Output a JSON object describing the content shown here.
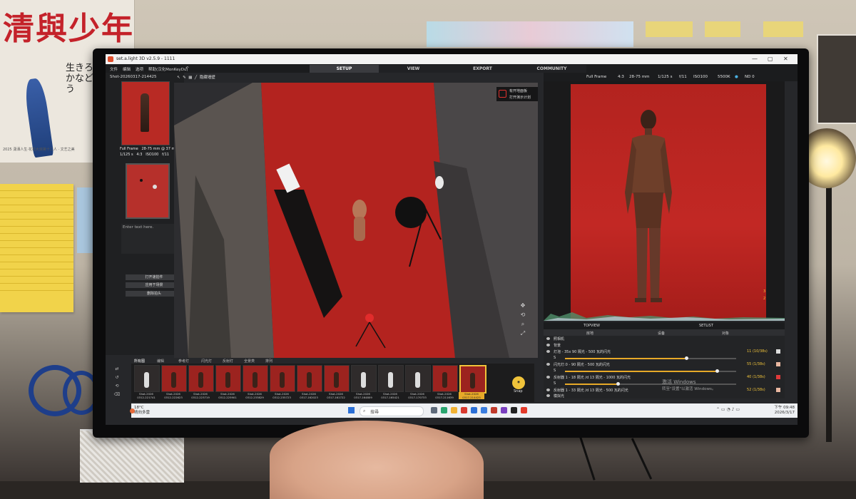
{
  "surroundings": {
    "poster_big_text": "清與少年",
    "poster_vertical_text": "生きろかなどう",
    "poster_fine_print": "2025 潇洒人生·花花大浪第十二人 · 文艺之美"
  },
  "window": {
    "title": "set.a.light 3D v2.5.9 - 1111",
    "controls": [
      "—",
      "▢",
      "✕"
    ]
  },
  "menu": {
    "items": [
      "文件",
      "编辑",
      "选项",
      "帮助(汉化MonKeyDu)"
    ]
  },
  "main_tabs": [
    {
      "label": "SETUP",
      "active": true
    },
    {
      "label": "VIEW",
      "active": false
    },
    {
      "label": "EXPORT",
      "active": false
    },
    {
      "label": "COMMUNITY",
      "active": false
    }
  ],
  "camera_toolbar": {
    "sensor": "Full Frame",
    "ratio": "4:3",
    "lens": "28-75 mm",
    "shutter": "1/125 s",
    "aperture": "f/11",
    "iso": "ISO100",
    "wb": "5500K",
    "nd": "ND 0"
  },
  "left_panel": {
    "shot_name": "Shot-20260317-214425",
    "sensor": "Full Frame",
    "lens_info": "28-75 mm @ 37 mm",
    "shutter": "1/125 s",
    "ratio": "4:3",
    "iso": "ISO100",
    "aperture": "f/11",
    "notes_placeholder": "Enter text here.",
    "buttons": [
      "打开速拍件",
      "应用于场景",
      "删除拍头"
    ]
  },
  "viewport": {
    "tool_label": "隐藏墙壁",
    "menu_items": [
      "有开地面板",
      "打开演示计划"
    ]
  },
  "bottom_tabs": {
    "left": "TOPVIEW",
    "right": "SETLIST",
    "sub": [
      "房地",
      "设备",
      "对象"
    ]
  },
  "lights": [
    {
      "label": "照相机",
      "value": ""
    },
    {
      "label": "背景",
      "value": ""
    },
    {
      "label": "灯泡 - 35x 90 隔光 - 500 瓦的闪光",
      "value": "11 (10/38s)"
    },
    {
      "label": "S",
      "value": ""
    },
    {
      "label": "闪光灯:0 - 90 隔光 - 500 瓦的闪光",
      "value": "55 (1/38s)"
    },
    {
      "label": "S",
      "value": ""
    },
    {
      "label": "反射器 1 - 18 隔光 /d 13 隔光 - 1000 瓦的闪光",
      "value": "40 (1/38s)"
    },
    {
      "label": "S",
      "value": ""
    },
    {
      "label": "反射器 1 - 33 隔光 /d 13 隔光 - 500 瓦的闪光",
      "value": "52 (1/38s)"
    },
    {
      "label": "模拟光",
      "value": ""
    }
  ],
  "watermark": {
    "line1": "激活 Windows",
    "line2": "转至\"设置\"以激活 Windows。"
  },
  "film_tabs": [
    "所有图",
    "编辑",
    "参考灯",
    "闪光灯",
    "反射灯",
    "全景类",
    "排列"
  ],
  "side_buttons": [
    "⇄",
    "↺",
    "⟲",
    "⌫"
  ],
  "filmstrip": [
    {
      "cap1": "Shot-2026",
      "cap2": "0312-221741"
    },
    {
      "cap1": "Shot-2026",
      "cap2": "0312-222623"
    },
    {
      "cap1": "Shot-2026",
      "cap2": "0312-223719"
    },
    {
      "cap1": "Shot-2026",
      "cap2": "0312-225901"
    },
    {
      "cap1": "Shot-2026",
      "cap2": "0312-233829"
    },
    {
      "cap1": "Shot-2026",
      "cap2": "0312-235723"
    },
    {
      "cap1": "Shot-2026",
      "cap2": "0317-162023"
    },
    {
      "cap1": "Shot-2026",
      "cap2": "0317-161722"
    },
    {
      "cap1": "Shot-2026",
      "cap2": "0317-164809"
    },
    {
      "cap1": "Shot-2026",
      "cap2": "0317-165421"
    },
    {
      "cap1": "Shot-2026",
      "cap2": "0317-170733"
    },
    {
      "cap1": "Shot-2026",
      "cap2": "0317-211639"
    },
    {
      "cap1": "Shot-2026",
      "cap2": "0317-214425"
    }
  ],
  "snap_label": "Snap",
  "taskbar": {
    "weather_temp": "18°C",
    "weather_desc": "晴向多雲",
    "search_placeholder": "搜尋",
    "time": "下午 09:48",
    "date": "2026/3/17"
  },
  "colors": {
    "accent": "#f0c33a",
    "backdrop_red": "#c22824"
  }
}
